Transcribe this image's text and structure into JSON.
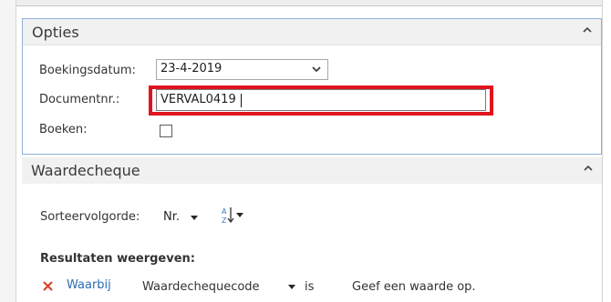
{
  "opties": {
    "title": "Opties",
    "boekingsdatum_label": "Boekingsdatum:",
    "boekingsdatum_value": "23-4-2019",
    "documentnr_label": "Documentnr.:",
    "documentnr_value": "VERVAL0419",
    "boeken_label": "Boeken:",
    "boeken_checked": false
  },
  "waardecheque": {
    "title": "Waardecheque",
    "sort_label": "Sorteervolgorde:",
    "sort_value": "Nr.",
    "sort_icon": "sort-az-icon",
    "results_label": "Resultaten weergeven:",
    "filter": {
      "remove_icon": "close-icon",
      "keyword": "Waarbij",
      "field": "Waardechequecode",
      "operator": "is",
      "value_placeholder": "Geef een waarde op."
    }
  },
  "colors": {
    "highlight_box": "#e0141e",
    "section_border": "#8fb3d9",
    "link": "#2e6cb3",
    "remove_icon": "#d9422b"
  }
}
